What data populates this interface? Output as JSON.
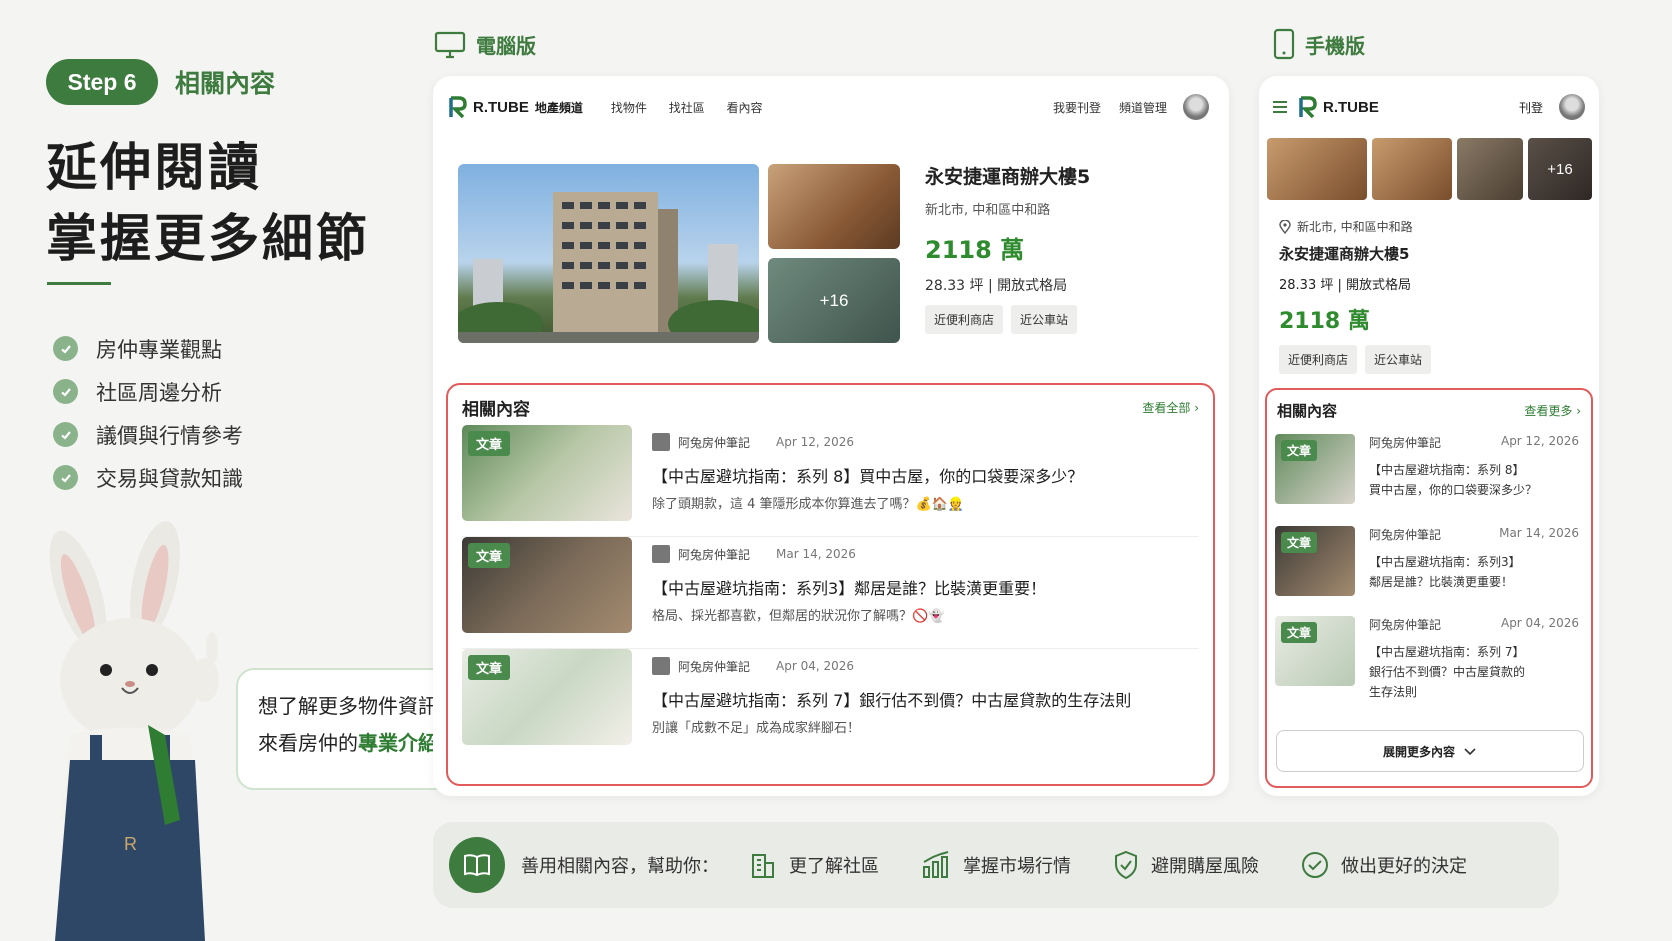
{
  "colors": {
    "accent": "#3e7b3f",
    "price": "#2e8b2e",
    "highlight_border": "#e25a5a",
    "background": "#f4f4f2"
  },
  "step": {
    "pill": "Step 6",
    "title": "相關內容"
  },
  "headline": {
    "line1": "延伸閱讀",
    "line2": "掌握更多細節"
  },
  "checks": [
    {
      "icon": "check-circle-icon",
      "label": "房仲專業觀點"
    },
    {
      "icon": "check-circle-icon",
      "label": "社區周邊分析"
    },
    {
      "icon": "check-circle-icon",
      "label": "議價與行情參考"
    },
    {
      "icon": "check-circle-icon",
      "label": "交易與貸款知識"
    }
  ],
  "bubble": {
    "line1": "想了解更多物件資訊，",
    "line2_pre": "來看房仲的",
    "line2_hl": "專業介紹",
    "line2_post": "！"
  },
  "labels": {
    "desktop": "電腦版",
    "mobile": "手機版"
  },
  "desktop": {
    "logo": "R.TUBE",
    "logo_sub": "地產頻道",
    "nav_links": [
      "找物件",
      "找社區",
      "看內容"
    ],
    "nav_right": [
      "我要刊登",
      "頻道管理"
    ],
    "property": {
      "title": "永安捷運商辦大樓5",
      "address": "新北市, 中和區中和路",
      "price": "2118 萬",
      "meta": "28.33 坪 | 開放式格局",
      "tags": [
        "近便利商店",
        "近公車站"
      ],
      "more_photos": "+16"
    },
    "related": {
      "title": "相關內容",
      "view_all": "查看全部",
      "articles": [
        {
          "badge": "文章",
          "author": "阿兔房仲筆記",
          "date": "Apr 12, 2026",
          "title": "【中古屋避坑指南：系列 8】買中古屋，你的口袋要深多少？",
          "desc": "除了頭期款，這 4 筆隱形成本你算進去了嗎？💰🏠👷"
        },
        {
          "badge": "文章",
          "author": "阿兔房仲筆記",
          "date": "Mar 14, 2026",
          "title": "【中古屋避坑指南：系列3】鄰居是誰？比裝潢更重要！",
          "desc": "格局、採光都喜歡，但鄰居的狀況你了解嗎？🚫👻"
        },
        {
          "badge": "文章",
          "author": "阿兔房仲筆記",
          "date": "Apr 04, 2026",
          "title": "【中古屋避坑指南：系列 7】銀行估不到價？中古屋貸款的生存法則",
          "desc": "別讓「成數不足」成為成家絆腳石！"
        }
      ]
    }
  },
  "mobile": {
    "logo": "R.TUBE",
    "nav_right": "刊登",
    "more_photos": "+16",
    "property": {
      "address": "新北市, 中和區中和路",
      "title": "永安捷運商辦大樓5",
      "meta": "28.33 坪 | 開放式格局",
      "price": "2118 萬",
      "tags": [
        "近便利商店",
        "近公車站"
      ]
    },
    "related": {
      "title": "相關內容",
      "view_more": "查看更多",
      "expand": "展開更多內容",
      "articles": [
        {
          "badge": "文章",
          "author": "阿兔房仲筆記",
          "date": "Apr 12, 2026",
          "line1": "【中古屋避坑指南：系列 8】",
          "line2": "買中古屋，你的口袋要深多少？"
        },
        {
          "badge": "文章",
          "author": "阿兔房仲筆記",
          "date": "Mar 14, 2026",
          "line1": "【中古屋避坑指南：系列3】",
          "line2": "鄰居是誰？比裝潢更重要！"
        },
        {
          "badge": "文章",
          "author": "阿兔房仲筆記",
          "date": "Apr 04, 2026",
          "line1": "【中古屋避坑指南：系列 7】",
          "line2": "銀行估不到價？中古屋貸款的",
          "line3": "生存法則"
        }
      ]
    }
  },
  "bottom_bar": {
    "lead": "善用相關內容，幫助你：",
    "items": [
      {
        "icon": "building-icon",
        "label": "更了解社區"
      },
      {
        "icon": "bar-chart-icon",
        "label": "掌握市場行情"
      },
      {
        "icon": "shield-check-icon",
        "label": "避開購屋風險"
      },
      {
        "icon": "check-circle-icon",
        "label": "做出更好的決定"
      }
    ]
  }
}
